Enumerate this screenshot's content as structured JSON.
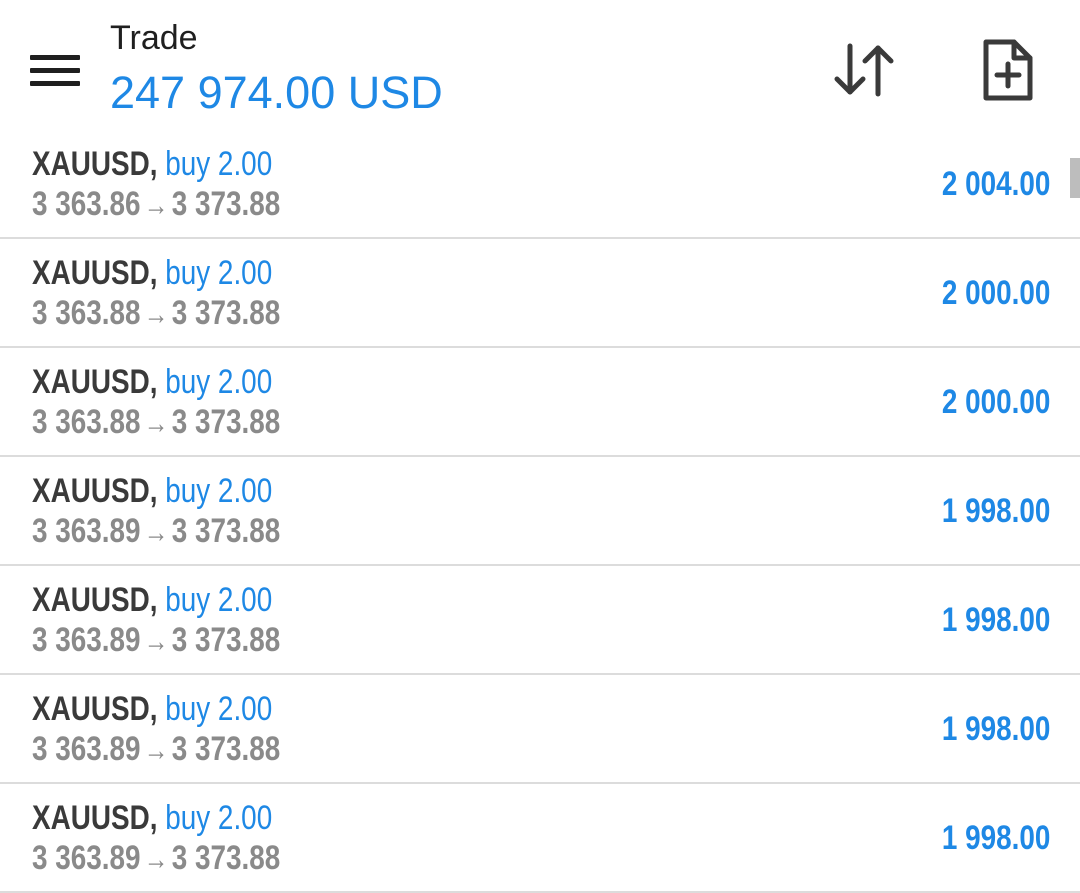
{
  "header": {
    "title": "Trade",
    "balance": "247 974.00 USD"
  },
  "icons": {
    "menu": "menu-icon",
    "sort": "sort-arrows-icon",
    "new_order": "file-plus-icon"
  },
  "colors": {
    "accent": "#1e88e5",
    "symbol": "#3a3a3a",
    "price": "#8a8a8a"
  },
  "trades": [
    {
      "symbol": "XAUUSD,",
      "side": "buy 2.00",
      "open": "3 363.86",
      "arrow": "→",
      "current": "3 373.88",
      "profit": "2 004.00"
    },
    {
      "symbol": "XAUUSD,",
      "side": "buy 2.00",
      "open": "3 363.88",
      "arrow": "→",
      "current": "3 373.88",
      "profit": "2 000.00"
    },
    {
      "symbol": "XAUUSD,",
      "side": "buy 2.00",
      "open": "3 363.88",
      "arrow": "→",
      "current": "3 373.88",
      "profit": "2 000.00"
    },
    {
      "symbol": "XAUUSD,",
      "side": "buy 2.00",
      "open": "3 363.89",
      "arrow": "→",
      "current": "3 373.88",
      "profit": "1 998.00"
    },
    {
      "symbol": "XAUUSD,",
      "side": "buy 2.00",
      "open": "3 363.89",
      "arrow": "→",
      "current": "3 373.88",
      "profit": "1 998.00"
    },
    {
      "symbol": "XAUUSD,",
      "side": "buy 2.00",
      "open": "3 363.89",
      "arrow": "→",
      "current": "3 373.88",
      "profit": "1 998.00"
    },
    {
      "symbol": "XAUUSD,",
      "side": "buy 2.00",
      "open": "3 363.89",
      "arrow": "→",
      "current": "3 373.88",
      "profit": "1 998.00"
    }
  ]
}
